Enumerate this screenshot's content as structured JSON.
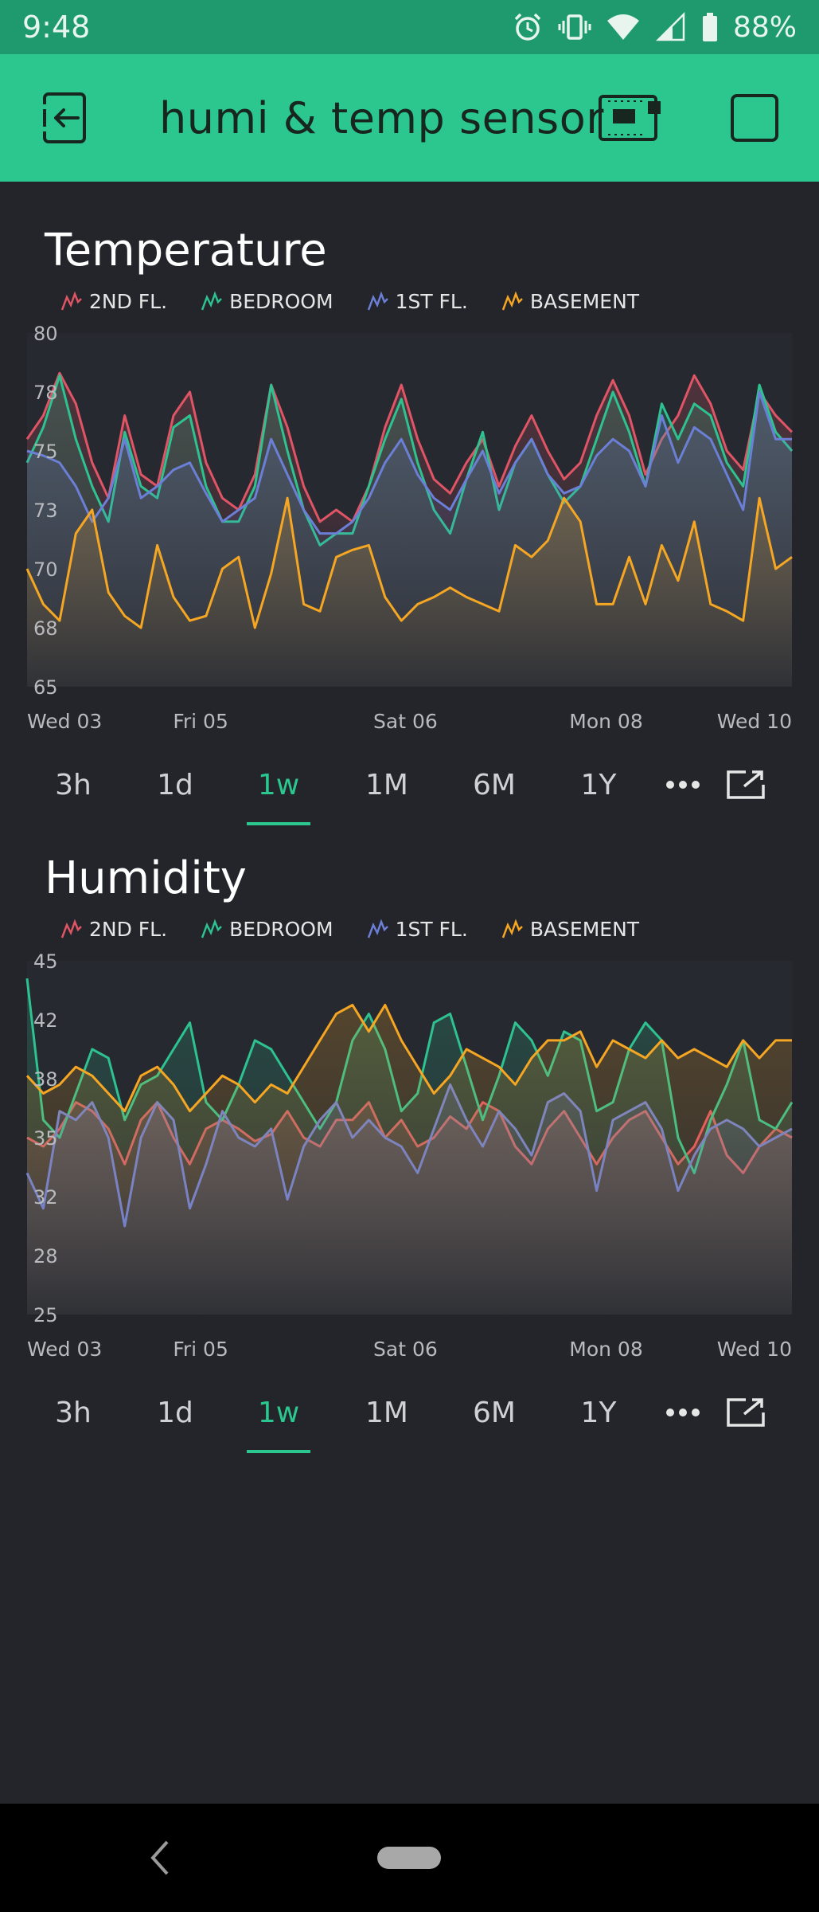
{
  "status": {
    "time": "9:48",
    "battery": "88%"
  },
  "app": {
    "title": "humi & temp sensor"
  },
  "range_options": [
    "3h",
    "1d",
    "1w",
    "1M",
    "6M",
    "1Y"
  ],
  "active_range": "1w",
  "colors": {
    "2nd_fl": "#e05566",
    "bedroom": "#2ec290",
    "1st_fl": "#6b7fd6",
    "basement": "#f5a623",
    "accent": "#2cc78f",
    "appbar": "#2cc78f"
  },
  "temperature": {
    "title": "Temperature",
    "legend": [
      "2ND FL.",
      "BEDROOM",
      "1ST FL.",
      "BASEMENT"
    ],
    "range_labels": [
      "3h",
      "1d",
      "1w",
      "1M",
      "6M",
      "1Y"
    ]
  },
  "humidity": {
    "title": "Humidity",
    "legend": [
      "2ND FL.",
      "BEDROOM",
      "1ST FL.",
      "BASEMENT"
    ],
    "range_labels": [
      "3h",
      "1d",
      "1w",
      "1M",
      "6M",
      "1Y"
    ]
  },
  "chart_data": [
    {
      "type": "line",
      "title": "Temperature",
      "ylim": [
        65,
        80
      ],
      "y_ticks": [
        "80",
        "78",
        "75",
        "73",
        "70",
        "68",
        "65"
      ],
      "y_tick_values": [
        80,
        77.5,
        75,
        72.5,
        70,
        67.5,
        65
      ],
      "x_tick_labels": [
        "Wed 03",
        "Fri 05",
        "Sat 06",
        "Mon 08",
        "Wed 10"
      ],
      "x_tick_fractions": [
        0.045,
        0.245,
        0.495,
        0.74,
        0.97
      ],
      "series": [
        {
          "name": "2ND FL.",
          "color": "#e05566",
          "values": [
            75.5,
            76.5,
            78.3,
            77,
            74.5,
            73,
            76.5,
            74,
            73.5,
            76.5,
            77.5,
            74.5,
            73,
            72.5,
            74,
            77.8,
            76,
            73.5,
            72,
            72.5,
            72,
            73.5,
            76,
            77.8,
            75.5,
            73.8,
            73.2,
            74.5,
            75.5,
            73.5,
            75.2,
            76.5,
            75,
            73.8,
            74.5,
            76.5,
            78,
            76.5,
            74,
            75.5,
            76.5,
            78.2,
            77,
            75,
            74.2,
            77.5,
            76.5,
            75.8
          ]
        },
        {
          "name": "BEDROOM",
          "color": "#2ec290",
          "values": [
            74.5,
            76,
            78.2,
            75.5,
            73.5,
            72,
            75.8,
            73.5,
            73,
            76,
            76.5,
            73.5,
            72,
            72,
            73.5,
            77.8,
            75,
            72.5,
            71,
            71.5,
            71.5,
            73.5,
            75.5,
            77.2,
            74.5,
            72.5,
            71.5,
            73.8,
            75.8,
            72.5,
            74.5,
            75.5,
            74,
            72.8,
            73.5,
            75.5,
            77.5,
            75.8,
            73.5,
            77,
            75.5,
            77,
            76.5,
            74.5,
            73.5,
            77.8,
            75.8,
            75
          ]
        },
        {
          "name": "1ST FL.",
          "color": "#6b7fd6",
          "values": [
            75,
            74.8,
            74.5,
            73.5,
            72,
            73,
            75.5,
            73,
            73.5,
            74.2,
            74.5,
            73.2,
            72,
            72.5,
            73,
            75.5,
            74,
            72.5,
            71.5,
            71.5,
            72,
            73,
            74.5,
            75.5,
            74,
            73,
            72.5,
            73.8,
            75,
            73.2,
            74.5,
            75.5,
            74,
            73.2,
            73.5,
            74.8,
            75.5,
            75,
            73.5,
            76.5,
            74.5,
            76,
            75.5,
            74,
            72.5,
            77.5,
            75.5,
            75.5
          ]
        },
        {
          "name": "BASEMENT",
          "color": "#f5a623",
          "values": [
            70,
            68.5,
            67.8,
            71.5,
            72.5,
            69,
            68,
            67.5,
            71,
            68.8,
            67.8,
            68,
            70,
            70.5,
            67.5,
            69.8,
            73,
            68.5,
            68.2,
            70.5,
            70.8,
            71,
            68.8,
            67.8,
            68.5,
            68.8,
            69.2,
            68.8,
            68.5,
            68.2,
            71,
            70.5,
            71.2,
            73,
            72,
            68.5,
            68.5,
            70.5,
            68.5,
            71,
            69.5,
            72,
            68.5,
            68.2,
            67.8,
            73,
            70,
            70.5
          ]
        }
      ]
    },
    {
      "type": "line",
      "title": "Humidity",
      "ylim": [
        25,
        45
      ],
      "y_ticks": [
        "45",
        "42",
        "38",
        "35",
        "32",
        "28",
        "25"
      ],
      "y_tick_values": [
        45,
        41.667,
        38.333,
        35,
        31.667,
        28.333,
        25
      ],
      "x_tick_labels": [
        "Wed 03",
        "Fri 05",
        "Sat 06",
        "Mon 08",
        "Wed 10"
      ],
      "x_tick_fractions": [
        0.045,
        0.245,
        0.495,
        0.74,
        0.97
      ],
      "series": [
        {
          "name": "2ND FL.",
          "color": "#e05566",
          "values": [
            35,
            34.5,
            35.5,
            37,
            36.5,
            35.5,
            33.5,
            36,
            37,
            35,
            33.5,
            35.5,
            36,
            35.5,
            34.8,
            35.2,
            36.5,
            35,
            34.5,
            36,
            36,
            37,
            35,
            36,
            34.5,
            35,
            36.2,
            35.5,
            37,
            36.5,
            34.5,
            33.5,
            35.5,
            36.5,
            35,
            33.5,
            35,
            36,
            36.5,
            35,
            33.5,
            34.5,
            36.5,
            34,
            33,
            34.5,
            35.5,
            35
          ]
        },
        {
          "name": "BEDROOM",
          "color": "#2ec290",
          "values": [
            44,
            36,
            35,
            37.5,
            40,
            39.5,
            36,
            38,
            38.5,
            40,
            41.5,
            37,
            36,
            38,
            40.5,
            40,
            38.5,
            37,
            35.5,
            37,
            40.5,
            42,
            40,
            36.5,
            37.5,
            41.5,
            42,
            39,
            36,
            38.5,
            41.5,
            40.5,
            38.5,
            41,
            40.5,
            36.5,
            37,
            40,
            41.5,
            40.5,
            35,
            33,
            36,
            38,
            40.5,
            36,
            35.5,
            37
          ]
        },
        {
          "name": "1ST FL.",
          "color": "#6b7fd6",
          "values": [
            33,
            31,
            36.5,
            36,
            37,
            35,
            30,
            35,
            37,
            36,
            31,
            33.5,
            36.5,
            35,
            34.5,
            35.5,
            31.5,
            34.5,
            36,
            37,
            35,
            36,
            35,
            34.5,
            33,
            35.5,
            38,
            36,
            34.5,
            36.5,
            35.5,
            34,
            37,
            37.5,
            36.5,
            32,
            36,
            36.5,
            37,
            35.5,
            32,
            34,
            35.5,
            36,
            35.5,
            34.5,
            35,
            35.5
          ]
        },
        {
          "name": "BASEMENT",
          "color": "#f5a623",
          "values": [
            38.5,
            37.5,
            38,
            39,
            38.5,
            37.5,
            36.5,
            38.5,
            39,
            38,
            36.5,
            37.5,
            38.5,
            38,
            37,
            38,
            37.5,
            39,
            40.5,
            42,
            42.5,
            41,
            42.5,
            40.5,
            39,
            37.5,
            38.5,
            40,
            39.5,
            39,
            38,
            39.5,
            40.5,
            40.5,
            41,
            39,
            40.5,
            40,
            39.5,
            40.5,
            39.5,
            40,
            39.5,
            39,
            40.5,
            39.5,
            40.5,
            40.5
          ]
        }
      ]
    }
  ]
}
